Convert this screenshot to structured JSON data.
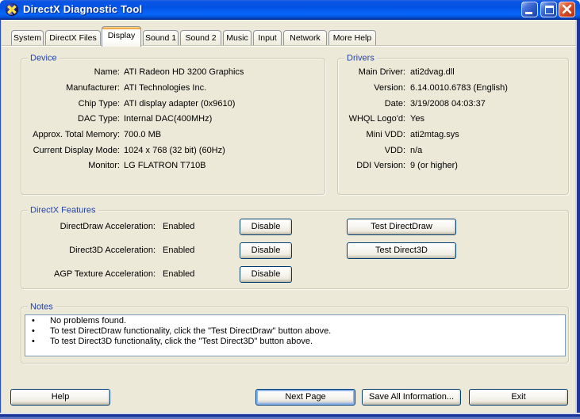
{
  "window": {
    "title": "DirectX Diagnostic Tool",
    "controls": {
      "minimize": "minimize",
      "maximize": "maximize",
      "close": "close"
    }
  },
  "colors": {
    "titlebar_blue": "#0353E4",
    "face": "#ECE9D8",
    "legend_blue": "#2443AC",
    "button_border": "#003C74",
    "active_tab_highlight": "#E68B2C",
    "close_red": "#D14521",
    "window_border_blue": "#16339B"
  },
  "tabs": [
    {
      "label": "System",
      "active": false
    },
    {
      "label": "DirectX Files",
      "active": false
    },
    {
      "label": "Display",
      "active": true
    },
    {
      "label": "Sound 1",
      "active": false
    },
    {
      "label": "Sound 2",
      "active": false
    },
    {
      "label": "Music",
      "active": false
    },
    {
      "label": "Input",
      "active": false
    },
    {
      "label": "Network",
      "active": false
    },
    {
      "label": "More Help",
      "active": false
    }
  ],
  "device": {
    "legend": "Device",
    "rows": [
      {
        "label": "Name:",
        "value": "ATI Radeon HD 3200 Graphics"
      },
      {
        "label": "Manufacturer:",
        "value": "ATI Technologies Inc."
      },
      {
        "label": "Chip Type:",
        "value": "ATI display adapter (0x9610)"
      },
      {
        "label": "DAC Type:",
        "value": "Internal DAC(400MHz)"
      },
      {
        "label": "Approx. Total Memory:",
        "value": "700.0 MB"
      },
      {
        "label": "Current Display Mode:",
        "value": "1024 x 768 (32 bit) (60Hz)"
      },
      {
        "label": "Monitor:",
        "value": "LG FLATRON T710B"
      }
    ]
  },
  "drivers": {
    "legend": "Drivers",
    "rows": [
      {
        "label": "Main Driver:",
        "value": "ati2dvag.dll"
      },
      {
        "label": "Version:",
        "value": "6.14.0010.6783 (English)"
      },
      {
        "label": "Date:",
        "value": "3/19/2008 04:03:37"
      },
      {
        "label": "WHQL Logo'd:",
        "value": "Yes"
      },
      {
        "label": "Mini VDD:",
        "value": "ati2mtag.sys"
      },
      {
        "label": "VDD:",
        "value": "n/a"
      },
      {
        "label": "DDI Version:",
        "value": "9 (or higher)"
      }
    ]
  },
  "features": {
    "legend": "DirectX Features",
    "rows": [
      {
        "label": "DirectDraw Acceleration:",
        "value": "Enabled",
        "disable_label": "Disable",
        "test_label": "Test DirectDraw"
      },
      {
        "label": "Direct3D Acceleration:",
        "value": "Enabled",
        "disable_label": "Disable",
        "test_label": "Test Direct3D"
      },
      {
        "label": "AGP Texture Acceleration:",
        "value": "Enabled",
        "disable_label": "Disable"
      }
    ]
  },
  "notes": {
    "legend": "Notes",
    "items": [
      "No problems found.",
      "To test DirectDraw functionality, click the \"Test DirectDraw\" button above.",
      "To test Direct3D functionality, click the \"Test Direct3D\" button above."
    ]
  },
  "footer": {
    "help": "Help",
    "next_page": "Next Page",
    "save_all": "Save All Information...",
    "exit": "Exit"
  }
}
